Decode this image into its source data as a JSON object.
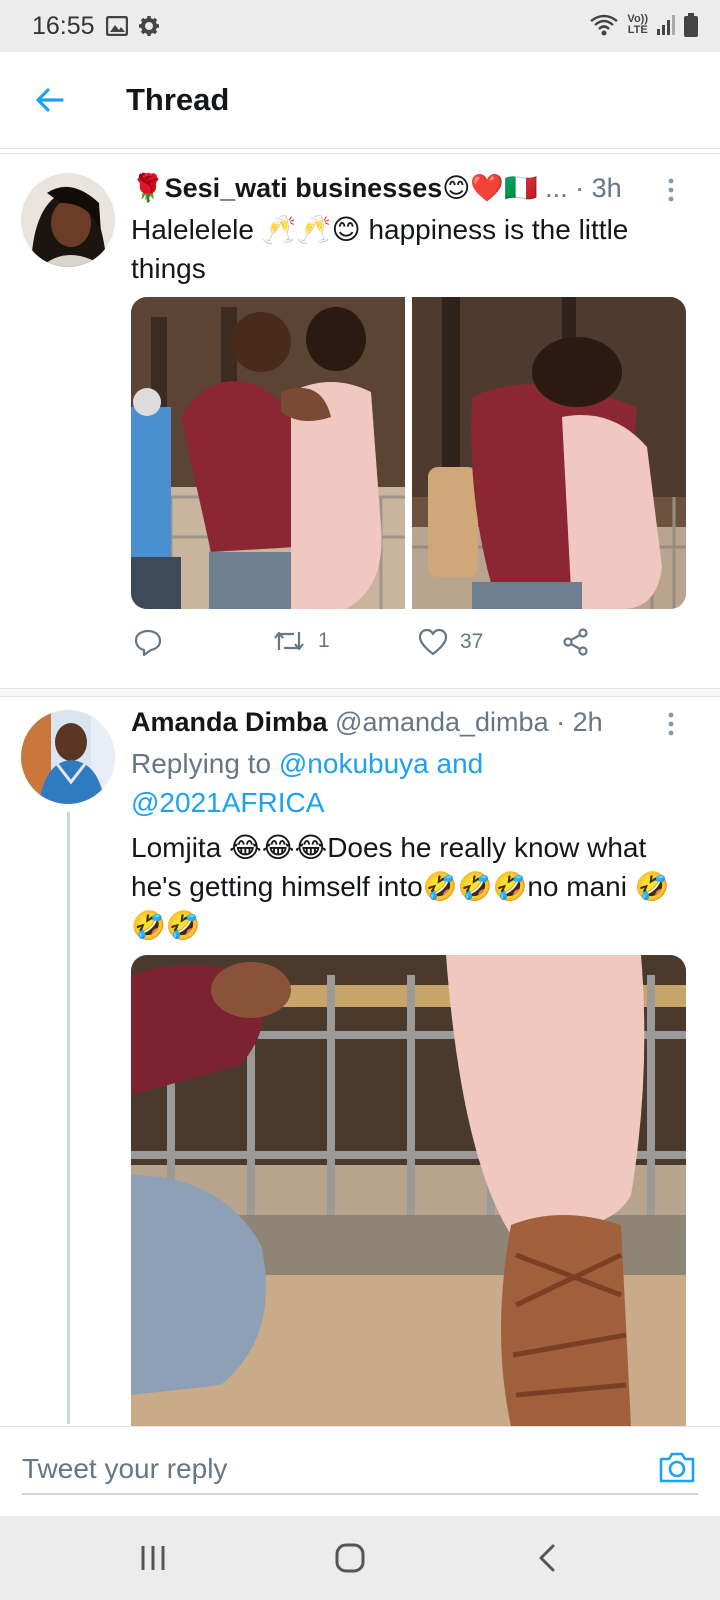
{
  "status_bar": {
    "time": "16:55",
    "icons": [
      "image-icon",
      "settings-icon",
      "wifi-icon",
      "volte-icon",
      "signal-icon",
      "battery-icon"
    ],
    "volte_label_top": "Vo))",
    "volte_label_bottom": "LTE"
  },
  "header": {
    "back_icon": "back-arrow-icon",
    "title": "Thread"
  },
  "tweets": [
    {
      "display_name": "🌹Sesi_wati businesses😊❤️🇮🇹",
      "ellipsis": " ...",
      "time": " · 3h",
      "text": "Halelelele 🥂🥂😊 happiness is the little things",
      "media_count": 2,
      "actions": {
        "reply_icon": "reply-icon",
        "retweet_icon": "retweet-icon",
        "retweet_count": "1",
        "like_icon": "like-icon",
        "like_count": "37",
        "share_icon": "share-icon"
      }
    },
    {
      "display_name": "Amanda Dimba",
      "handle": " @amanda_dimba",
      "time": " · 2h",
      "replying_to_prefix": "Replying to ",
      "replying_to_1": "@nokubuya and",
      "replying_to_2": "@2021AFRICA",
      "text": "Lomjita 😂😂😂Does he really know what he's getting himself into🤣🤣🤣no mani 🤣🤣🤣",
      "media_count": 1
    }
  ],
  "reply_bar": {
    "placeholder": "Tweet your reply",
    "camera_icon": "camera-icon"
  },
  "nav_bar": {
    "buttons": [
      "recent-apps-icon",
      "home-icon",
      "back-icon"
    ]
  },
  "colors": {
    "accent": "#1da1f2",
    "text": "#14171a",
    "secondary": "#657786",
    "divider": "#dfe3e6"
  }
}
